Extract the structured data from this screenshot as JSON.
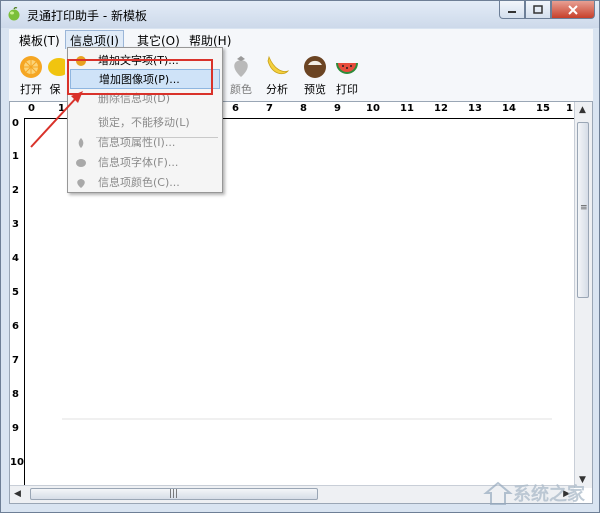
{
  "window": {
    "title": "灵通打印助手 - 新模板",
    "accent": "#6e7f96"
  },
  "menubar": {
    "items": [
      {
        "label": "模板(T)"
      },
      {
        "label": "信息项(I)"
      },
      {
        "label": "其它(O)"
      },
      {
        "label": "帮助(H)"
      }
    ]
  },
  "toolbar": {
    "items": [
      {
        "label": "打开",
        "icon": "orange-icon",
        "disabled": false
      },
      {
        "label": "保",
        "icon": "lemon-icon",
        "disabled": false
      },
      {
        "label": "颜色",
        "icon": "strawberry-icon",
        "disabled": true
      },
      {
        "label": "分析",
        "icon": "banana-icon",
        "disabled": false
      },
      {
        "label": "预览",
        "icon": "coconut-icon",
        "disabled": false
      },
      {
        "label": "打印",
        "icon": "watermelon-icon",
        "disabled": false
      }
    ]
  },
  "dropdown": {
    "items": [
      {
        "label": "增加文字项(T)...",
        "disabled": false,
        "highlight": false
      },
      {
        "label": "增加图像项(P)...",
        "disabled": false,
        "highlight": true
      },
      {
        "label": "删除信息项(D)",
        "disabled": true,
        "highlight": false
      },
      {
        "label": "锁定，不能移动(L)",
        "disabled": true,
        "highlight": false
      },
      {
        "label": "信息项属性(I)...",
        "disabled": true,
        "highlight": false
      },
      {
        "label": "信息项字体(F)...",
        "disabled": true,
        "highlight": false
      },
      {
        "label": "信息项颜色(C)...",
        "disabled": true,
        "highlight": false
      }
    ],
    "highlight_color": "#cfe3f8"
  },
  "ruler": {
    "top": [
      "0",
      "1",
      "6",
      "7",
      "8",
      "9",
      "10",
      "11",
      "12",
      "13",
      "14",
      "15",
      "1"
    ],
    "left": [
      "0",
      "1",
      "2",
      "3",
      "4",
      "5",
      "6",
      "7",
      "8",
      "9",
      "10"
    ]
  },
  "annotation": {
    "color": "#d9322a"
  },
  "watermark": {
    "text": "系统之家"
  }
}
